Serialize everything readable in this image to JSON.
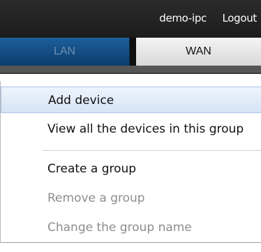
{
  "header": {
    "username": "demo-ipc",
    "logout_label": "Logout"
  },
  "tabs": [
    {
      "label": "LAN",
      "active": false
    },
    {
      "label": "WAN",
      "active": true
    }
  ],
  "context_menu": {
    "items": [
      {
        "label": "Add device",
        "state": "hovered"
      },
      {
        "label": "View all the devices in this group",
        "state": "enabled"
      },
      {
        "label": "Create a group",
        "state": "enabled"
      },
      {
        "label": "Remove a group",
        "state": "disabled"
      },
      {
        "label": "Change the group name",
        "state": "disabled"
      }
    ]
  },
  "colors": {
    "topbar": "#1c1c1c",
    "lan_tab": "#0a3d6e",
    "wan_tab": "#e6e6e6",
    "hover_highlight": "#d6e4f6",
    "disabled_text": "#8d8d8d"
  }
}
